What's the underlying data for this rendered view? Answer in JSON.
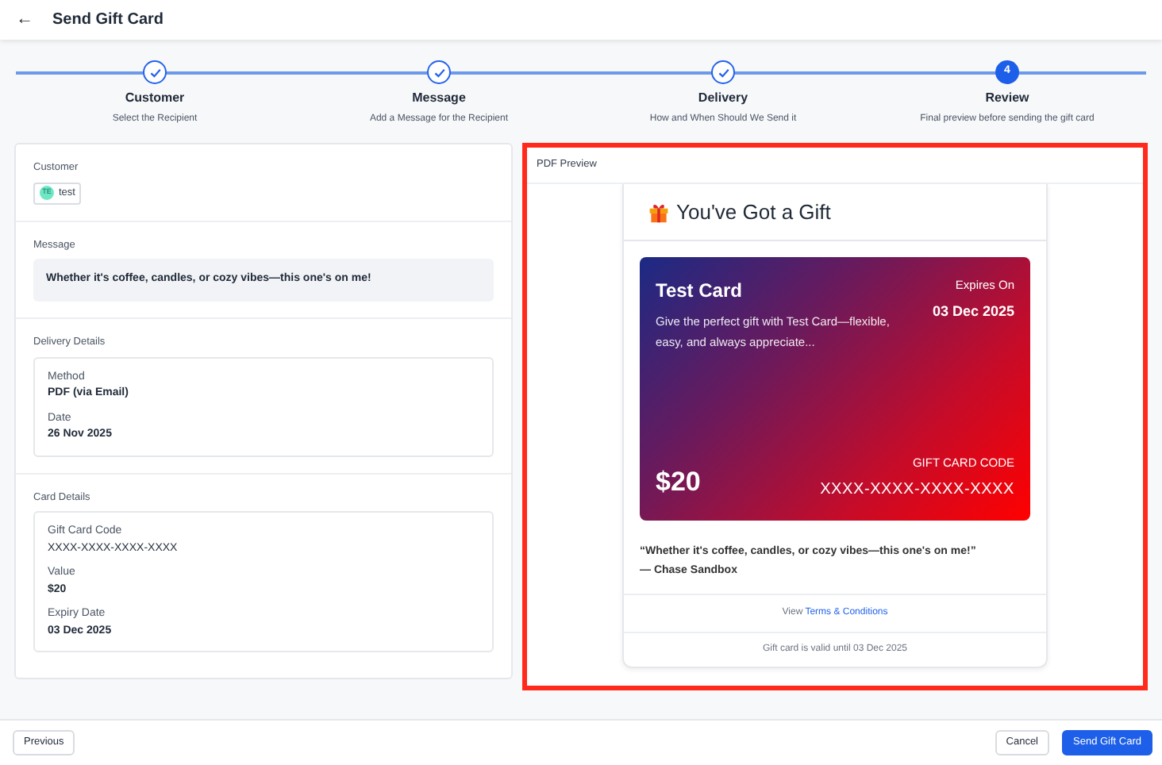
{
  "header": {
    "back": "←",
    "title": "Send Gift Card"
  },
  "steps": [
    {
      "title": "Customer",
      "subtitle": "Select the Recipient",
      "completed": true,
      "selected": false
    },
    {
      "title": "Message",
      "subtitle": "Add a Message for the Recipient",
      "completed": true,
      "selected": false
    },
    {
      "title": "Delivery",
      "subtitle": "How and When Should We Send it",
      "completed": true,
      "selected": false
    },
    {
      "title": "Review",
      "subtitle": "Final preview before sending the gift card",
      "completed": false,
      "selected": true,
      "number": "4"
    }
  ],
  "summary": {
    "customer": {
      "label": "Customer",
      "initials": "TE",
      "name": "test"
    },
    "message": {
      "label": "Message",
      "text": "Whether it's coffee, candles, or cozy vibes—this one's on me!"
    },
    "sections": [
      {
        "label": "Delivery Details",
        "fields": [
          {
            "label": "Method",
            "value": "PDF (via Email)",
            "bold": true
          },
          {
            "label": "Date",
            "value": "26 Nov 2025",
            "bold": true
          }
        ]
      },
      {
        "label": "Card Details",
        "fields": [
          {
            "label": "Gift Card Code",
            "value": "XXXX-XXXX-XXXX-XXXX",
            "bold": false
          },
          {
            "label": "Value",
            "value": "$20",
            "bold": true
          },
          {
            "label": "Expiry Date",
            "value": "03 Dec 2025",
            "bold": true
          }
        ]
      }
    ]
  },
  "preview": {
    "label": "PDF Preview",
    "highlighted": true,
    "heading": "You've Got a Gift",
    "card": {
      "name": "Test Card",
      "description": "Give the perfect gift with Test Card—flexible, easy, and always appreciate...",
      "expires_label": "Expires On",
      "expires": "03 Dec 2025",
      "amount": "$20",
      "code_label": "GIFT CARD CODE",
      "code": "XXXX-XXXX-XXXX-XXXX"
    },
    "quote": "“Whether it's coffee, candles, or cozy vibes—this one's on me!”",
    "sender": "— Chase Sandbox",
    "terms_prefix": "View",
    "terms_link": "Terms & Conditions",
    "validity": "Gift card is valid until 03 Dec 2025"
  },
  "footer": {
    "previous": "Previous",
    "cancel": "Cancel",
    "submit": "Send Gift Card"
  }
}
